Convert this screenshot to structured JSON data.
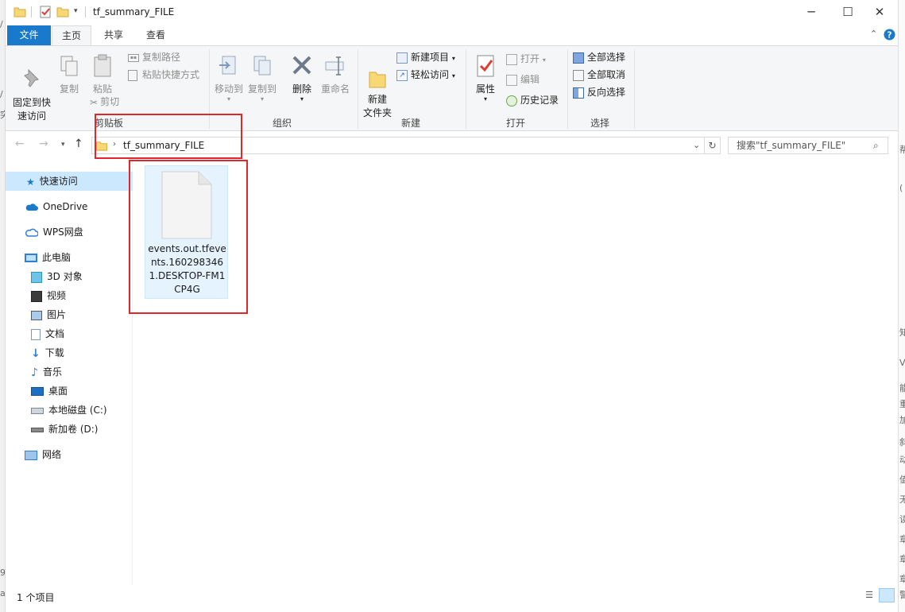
{
  "window": {
    "title": "tf_summary_FILE"
  },
  "tabs": [
    {
      "label": "文件"
    },
    {
      "label": "主页"
    },
    {
      "label": "共享"
    },
    {
      "label": "查看"
    }
  ],
  "ribbon": {
    "clipboard": {
      "pin": "固定到快\n速访问",
      "copy": "复制",
      "paste": "粘贴",
      "copy_path": "复制路径",
      "paste_shortcut": "粘贴快捷方式",
      "cut": "剪切",
      "group": "剪贴板"
    },
    "organize": {
      "move_to": "移动到",
      "copy_to": "复制到",
      "delete": "删除",
      "rename": "重命名",
      "group": "组织"
    },
    "new": {
      "new_folder": "新建\n文件夹",
      "new_item": "新建项目",
      "easy_access": "轻松访问",
      "group": "新建"
    },
    "open": {
      "properties": "属性",
      "open": "打开",
      "edit": "编辑",
      "history": "历史记录",
      "group": "打开"
    },
    "select": {
      "select_all": "全部选择",
      "select_none": "全部取消",
      "invert": "反向选择",
      "group": "选择"
    }
  },
  "address": {
    "path": "tf_summary_FILE",
    "search_placeholder": "搜索\"tf_summary_FILE\""
  },
  "nav": [
    {
      "label": "快速访问"
    },
    {
      "label": "OneDrive"
    },
    {
      "label": "WPS网盘"
    },
    {
      "label": "此电脑"
    },
    {
      "label": "3D 对象"
    },
    {
      "label": "视频"
    },
    {
      "label": "图片"
    },
    {
      "label": "文档"
    },
    {
      "label": "下载"
    },
    {
      "label": "音乐"
    },
    {
      "label": "桌面"
    },
    {
      "label": "本地磁盘 (C:)"
    },
    {
      "label": "新加卷 (D:)"
    },
    {
      "label": "网络"
    }
  ],
  "files": [
    {
      "name": "events.out.tfevents.1602983461.DESKTOP-FM1CP4G"
    }
  ],
  "status": {
    "count": "1 个项目"
  },
  "colors": {
    "accent": "#1979ca",
    "highlight_box": "#e3262c",
    "selection": "#e5f3ff"
  }
}
